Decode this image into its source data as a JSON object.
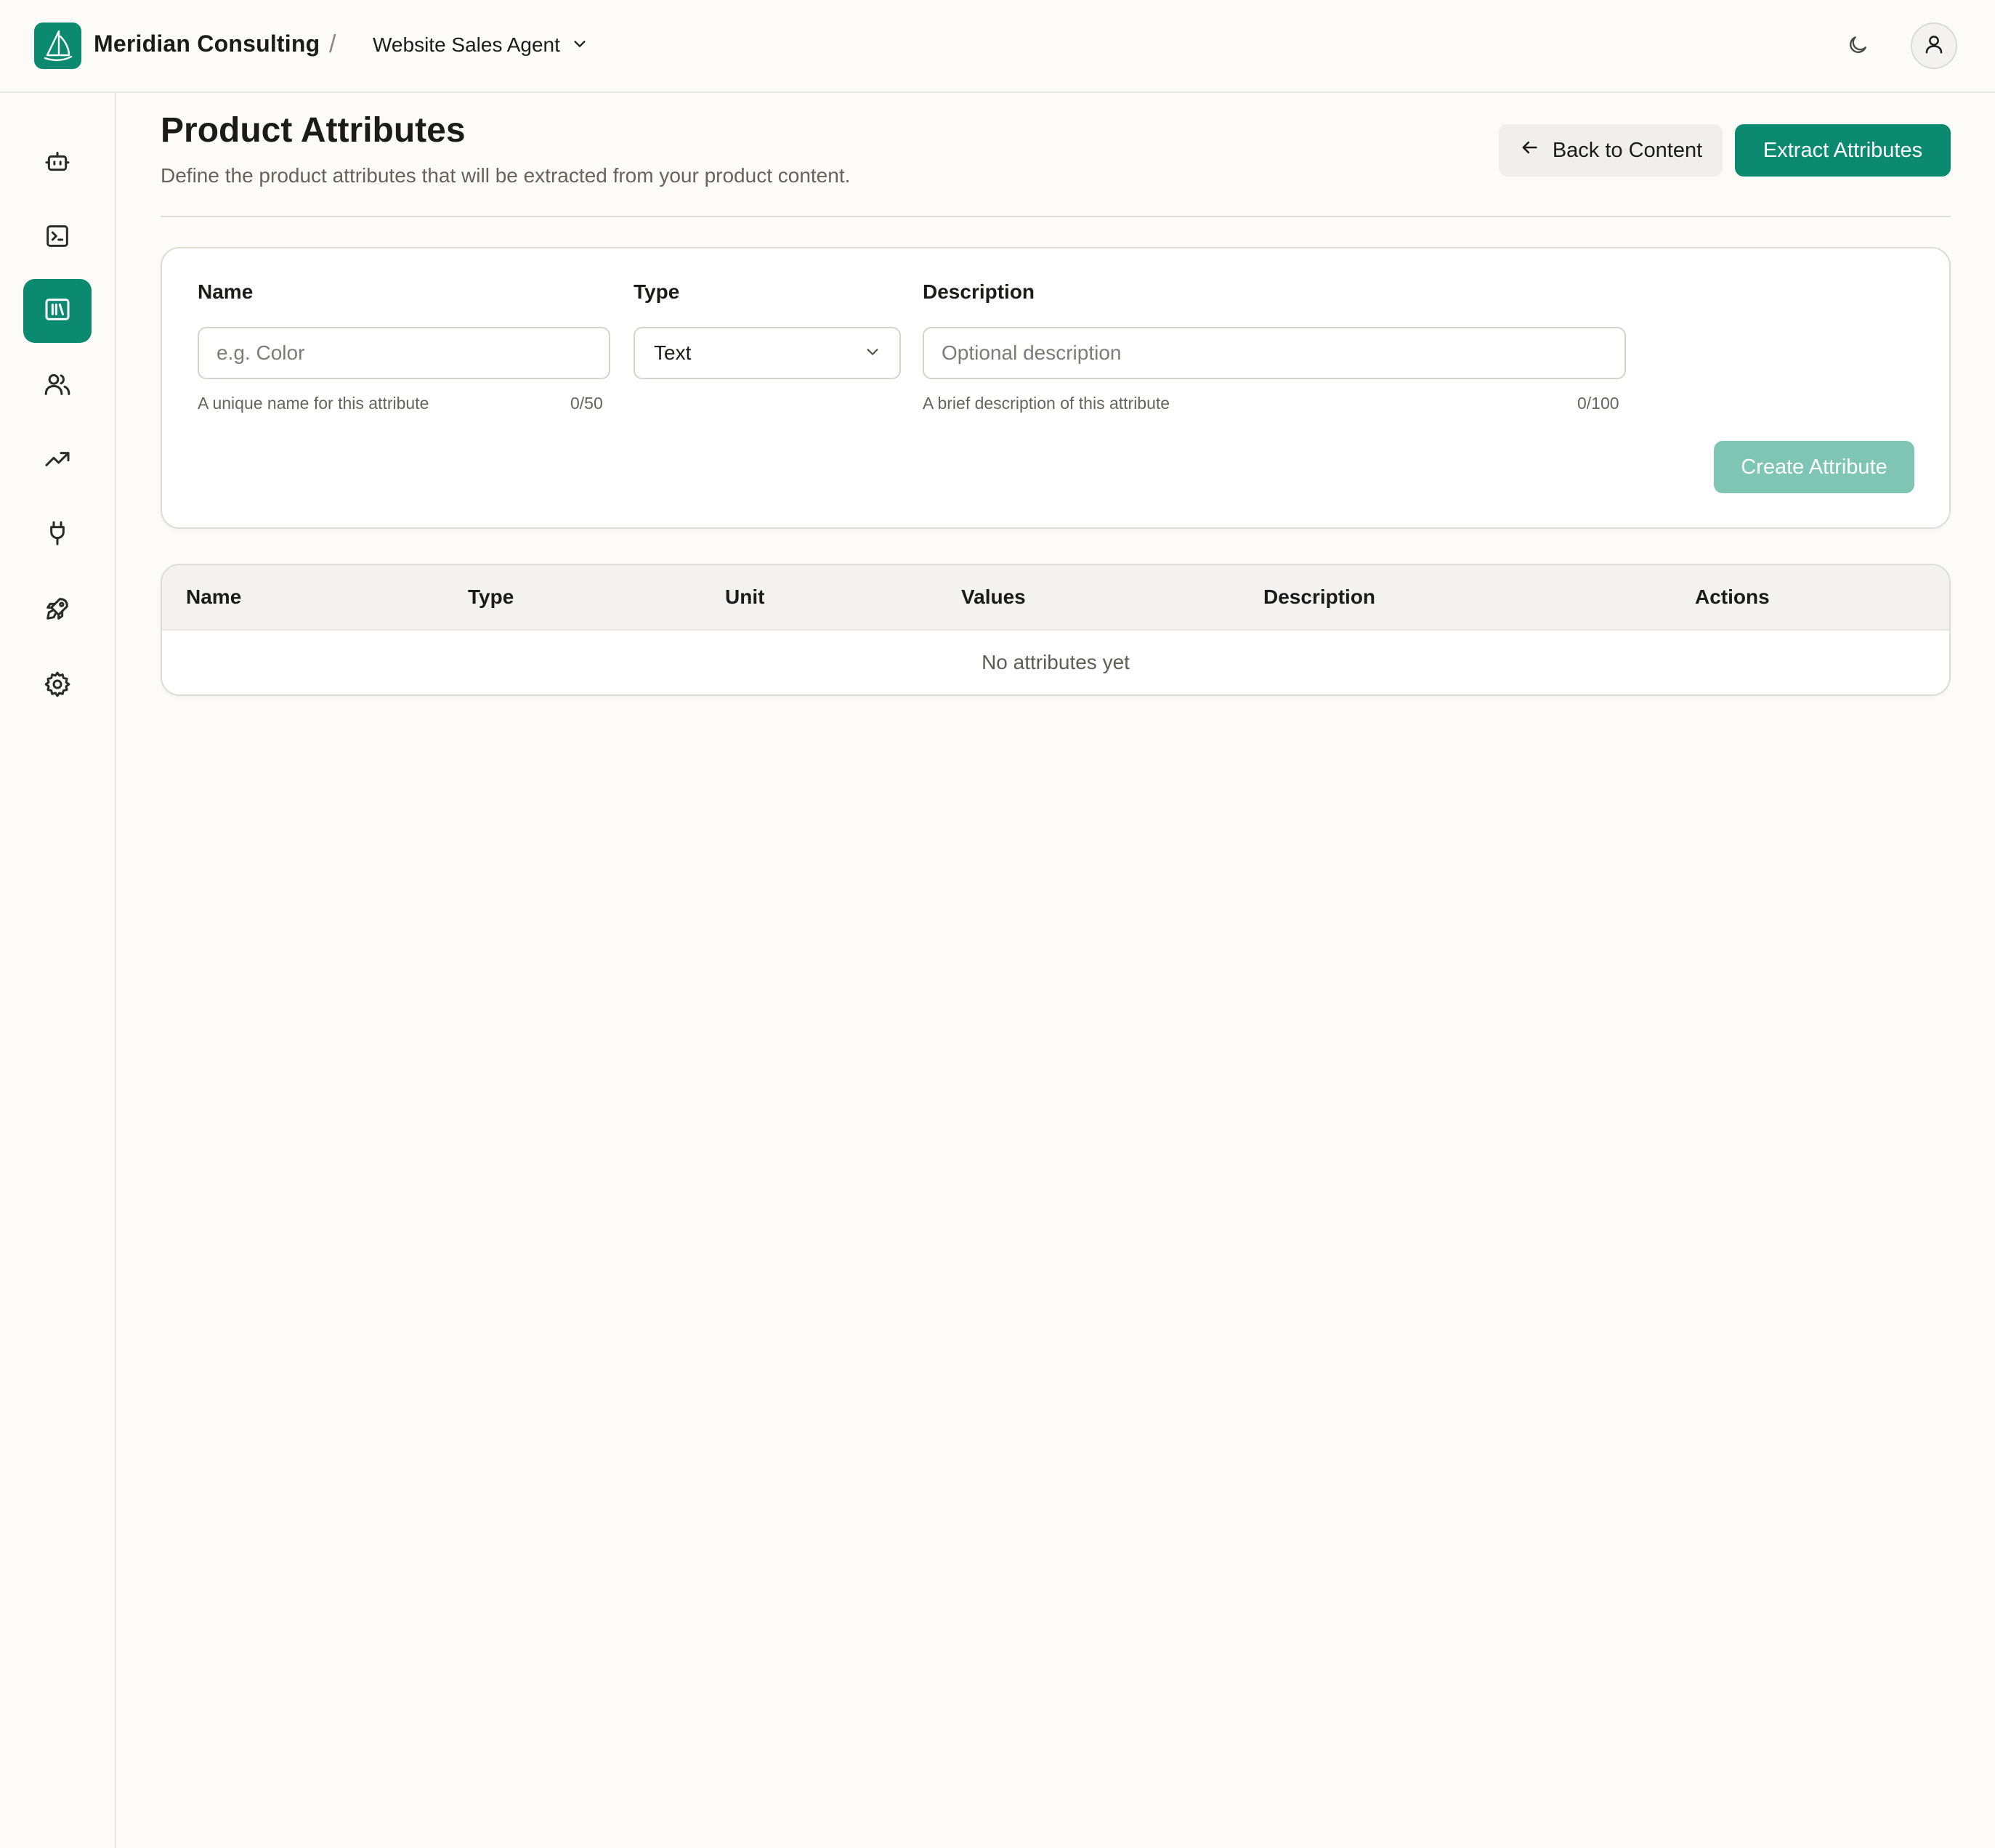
{
  "header": {
    "brand_name": "Meridian Consulting",
    "separator": "/",
    "agent_name": "Website Sales Agent",
    "icons": {
      "logo": "sailboat-icon",
      "agent_dropdown": "chevron-down-icon",
      "theme": "moon-icon",
      "user": "user-icon"
    }
  },
  "sidebar": {
    "items": [
      {
        "name": "bot",
        "icon": "bot-icon",
        "active": false
      },
      {
        "name": "terminal",
        "icon": "terminal-icon",
        "active": false
      },
      {
        "name": "library",
        "icon": "library-icon",
        "active": true
      },
      {
        "name": "users",
        "icon": "users-icon",
        "active": false
      },
      {
        "name": "analytics",
        "icon": "trending-up-icon",
        "active": false
      },
      {
        "name": "integrations",
        "icon": "plug-icon",
        "active": false
      },
      {
        "name": "deploy",
        "icon": "rocket-icon",
        "active": false
      },
      {
        "name": "settings",
        "icon": "gear-icon",
        "active": false
      }
    ]
  },
  "page": {
    "title": "Product Attributes",
    "subtitle": "Define the product attributes that will be extracted from your product content.",
    "back_label": "Back to Content",
    "extract_label": "Extract Attributes"
  },
  "form": {
    "name_label": "Name",
    "name_placeholder": "e.g. Color",
    "name_hint": "A unique name for this attribute",
    "name_counter": "0/50",
    "type_label": "Type",
    "type_value": "Text",
    "description_label": "Description",
    "description_placeholder": "Optional description",
    "description_hint": "A brief description of this attribute",
    "description_counter": "0/100",
    "create_label": "Create Attribute"
  },
  "table": {
    "columns": [
      "Name",
      "Type",
      "Unit",
      "Values",
      "Description",
      "Actions"
    ],
    "empty_message": "No attributes yet"
  },
  "colors": {
    "accent": "#0b8a6f",
    "accent_disabled": "#7fc5b4",
    "background": "#fcfbf8"
  }
}
